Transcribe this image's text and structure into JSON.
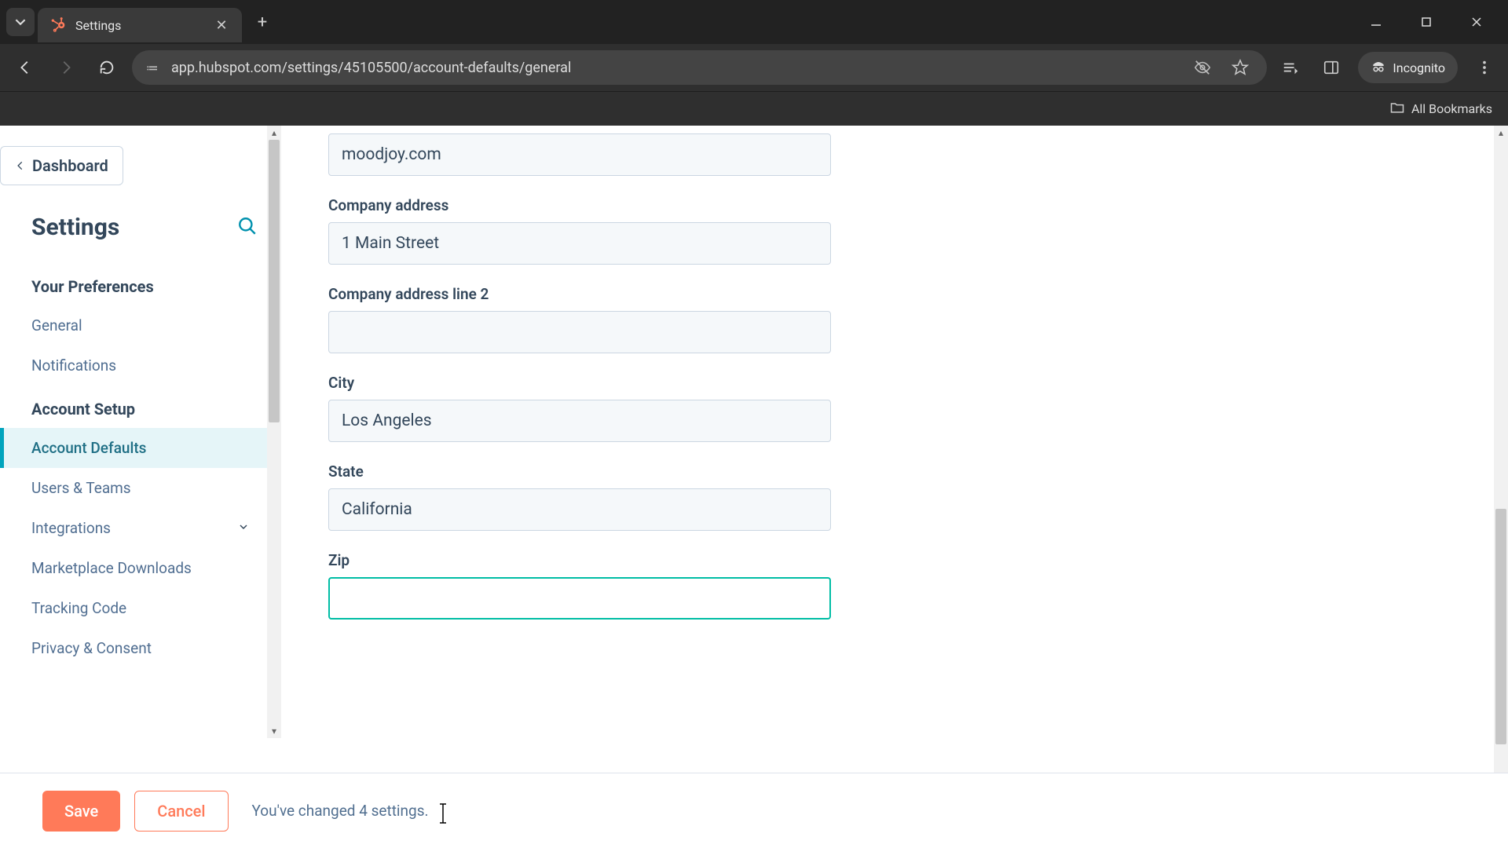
{
  "browser": {
    "tab_title": "Settings",
    "url": "app.hubspot.com/settings/45105500/account-defaults/general",
    "incognito_label": "Incognito",
    "all_bookmarks": "All Bookmarks"
  },
  "sidebar": {
    "back_label": "Dashboard",
    "title": "Settings",
    "sections": [
      {
        "title": "Your Preferences",
        "items": [
          {
            "label": "General",
            "active": false
          },
          {
            "label": "Notifications",
            "active": false
          }
        ]
      },
      {
        "title": "Account Setup",
        "items": [
          {
            "label": "Account Defaults",
            "active": true
          },
          {
            "label": "Users & Teams",
            "active": false
          },
          {
            "label": "Integrations",
            "active": false,
            "expandable": true
          },
          {
            "label": "Marketplace Downloads",
            "active": false
          },
          {
            "label": "Tracking Code",
            "active": false
          },
          {
            "label": "Privacy & Consent",
            "active": false
          }
        ]
      }
    ]
  },
  "form": {
    "fields": [
      {
        "id": "domain",
        "label": "",
        "value": "moodjoy.com",
        "focused": false
      },
      {
        "id": "address1",
        "label": "Company address",
        "value": "1 Main Street",
        "focused": false
      },
      {
        "id": "address2",
        "label": "Company address line 2",
        "value": "",
        "focused": false
      },
      {
        "id": "city",
        "label": "City",
        "value": "Los Angeles",
        "focused": false
      },
      {
        "id": "state",
        "label": "State",
        "value": "California",
        "focused": false
      },
      {
        "id": "zip",
        "label": "Zip",
        "value": "",
        "focused": true
      }
    ]
  },
  "savebar": {
    "save": "Save",
    "cancel": "Cancel",
    "message": "You've changed 4 settings."
  }
}
